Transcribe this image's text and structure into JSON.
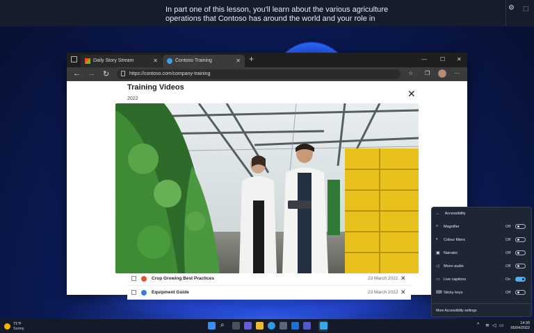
{
  "live_captions": {
    "text_line1": "In part one of this lesson, you'll learn about the various agriculture",
    "text_line2": "operations that Contoso has around the world and your role in",
    "settings_icon": "gear-icon",
    "pin_icon": "pin-icon"
  },
  "browser": {
    "tabs": [
      {
        "label": "Daily Story Stream",
        "favicon": "story-icon",
        "active": false
      },
      {
        "label": "Contoso Training",
        "favicon": "contoso-icon",
        "active": true
      }
    ],
    "address": "https://contoso.com/company-training",
    "page": {
      "title": "Training Videos",
      "year": "2022",
      "list": [
        {
          "name": "Crop Growing Best Practices",
          "date": "23 March 2022",
          "icon_color": "#e2552b"
        },
        {
          "name": "Equipment Guide",
          "date": "23 March 2022",
          "icon_color": "#3a7bd5"
        }
      ]
    }
  },
  "accessibility": {
    "title": "Accessibility",
    "items": [
      {
        "label": "Magnifier",
        "state": "Off",
        "on": false,
        "icon": "magnifier-icon"
      },
      {
        "label": "Colour filters",
        "state": "Off",
        "on": false,
        "icon": "colour-filters-icon"
      },
      {
        "label": "Narrator",
        "state": "Off",
        "on": false,
        "icon": "narrator-icon"
      },
      {
        "label": "Mono audio",
        "state": "Off",
        "on": false,
        "icon": "mono-audio-icon"
      },
      {
        "label": "Live captions",
        "state": "On",
        "on": true,
        "icon": "live-captions-icon"
      },
      {
        "label": "Sticky keys",
        "state": "Off",
        "on": false,
        "icon": "sticky-keys-icon"
      }
    ],
    "more": "More Accessibility settings"
  },
  "taskbar": {
    "weather_temp": "71°F",
    "weather_cond": "Sunny",
    "time": "14:30",
    "date": "05/04/2022"
  },
  "colors": {
    "accent": "#4fb0f0",
    "caption_bg": "#161c2b",
    "taskbar_bg": "#141a27"
  }
}
